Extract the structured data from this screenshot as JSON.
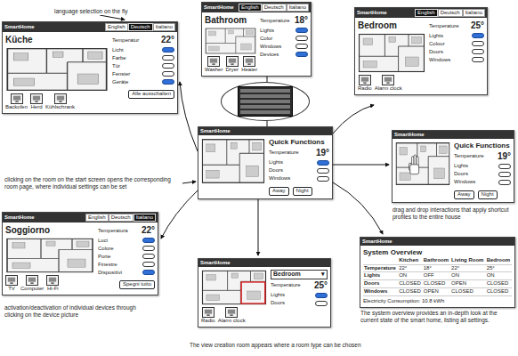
{
  "brand": "SmartHome",
  "annotations": [
    "language selection on the fly",
    "clicking on the room on the start screen opens the corresponding room page, where individual settings can be set",
    "activation/deactivation of individual devices through clicking on the device picture",
    "The view creation room appears where a room type can be chosen",
    "drag and drop interactions that apply shortcut profiles to the entire house",
    "The system overview provides an in-depth look at the current state of the smart home, listing all settings."
  ],
  "windows": [
    {
      "kind": "room",
      "title": "Küche",
      "languages": [
        {
          "label": "English",
          "selected": false
        },
        {
          "label": "Deutsch",
          "selected": true
        },
        {
          "label": "Italiano",
          "selected": false
        }
      ],
      "temperature": {
        "label": "Temperatur",
        "value": "22°"
      },
      "rows": [
        {
          "label": "Licht",
          "on": true
        },
        {
          "label": "Farbe",
          "on": false
        },
        {
          "label": "Tür",
          "on": false
        },
        {
          "label": "Fenster",
          "on": false
        },
        {
          "label": "Geräte",
          "on": true
        }
      ],
      "devices": [
        "Backofen",
        "Herd",
        "Kühlschrank"
      ],
      "button": "Alle ausschalten"
    },
    {
      "kind": "room",
      "title": "Bathroom",
      "languages": [
        {
          "label": "English",
          "selected": true
        },
        {
          "label": "Deutsch",
          "selected": false
        },
        {
          "label": "Italiano",
          "selected": false
        }
      ],
      "temperature": {
        "label": "Temperature",
        "value": "18°"
      },
      "rows": [
        {
          "label": "Lights",
          "on": true
        },
        {
          "label": "Color",
          "on": false
        },
        {
          "label": "Windows",
          "on": false
        },
        {
          "label": "Devices",
          "on": true
        }
      ],
      "devices": [
        "Washer",
        "Dryer",
        "Heater"
      ]
    },
    {
      "kind": "room",
      "title": "Bedroom",
      "languages": [
        {
          "label": "English",
          "selected": true
        },
        {
          "label": "Deutsch",
          "selected": false
        },
        {
          "label": "Italiano",
          "selected": false
        }
      ],
      "temperature": {
        "label": "Temperature",
        "value": "25°"
      },
      "rows": [
        {
          "label": "Lights",
          "on": true
        },
        {
          "label": "Colour",
          "on": false
        },
        {
          "label": "Doors",
          "on": false
        },
        {
          "label": "Windows",
          "on": false
        }
      ],
      "devices": [
        "Radio",
        "Alarm clock"
      ]
    },
    {
      "kind": "room",
      "title": "Soggiorno",
      "languages": [
        {
          "label": "English",
          "selected": false
        },
        {
          "label": "Deutsch",
          "selected": false
        },
        {
          "label": "Italiano",
          "selected": true
        }
      ],
      "temperature": {
        "label": "Temperatura",
        "value": "22°"
      },
      "rows": [
        {
          "label": "Luci",
          "on": true
        },
        {
          "label": "Colore",
          "on": false
        },
        {
          "label": "Porte",
          "on": false
        },
        {
          "label": "Finestre",
          "on": false
        },
        {
          "label": "Dispositivi",
          "on": true
        }
      ],
      "devices": [
        "TV",
        "Computer",
        "Hi-Fi"
      ],
      "button": "Spegni tutto"
    },
    {
      "kind": "quick",
      "title": "Quick Functions",
      "temperature": {
        "label": "Temperature",
        "value": "19°"
      },
      "rows": [
        {
          "label": "Lights",
          "on": true
        },
        {
          "label": "Doors",
          "on": false
        },
        {
          "label": "Windows",
          "on": false
        }
      ],
      "shortcuts": [
        "Away",
        "Night"
      ]
    },
    {
      "kind": "quick",
      "title": "Quick Functions",
      "cursor": true,
      "temperature": {
        "label": "Temperature",
        "value": "19°"
      },
      "rows": [
        {
          "label": "Lights",
          "on": false
        },
        {
          "label": "Doors",
          "on": false
        },
        {
          "label": "Windows",
          "on": false
        }
      ],
      "shortcuts": [
        "Away",
        "Night"
      ]
    },
    {
      "kind": "create",
      "room_type": "Bedroom",
      "dropdown_icon": "▾",
      "highlight": true,
      "temperature": {
        "label": "Temperature",
        "value": "25°"
      },
      "rows": [
        {
          "label": "Lights",
          "on": true
        },
        {
          "label": "Doors",
          "on": false
        }
      ],
      "devices": [
        "Radio",
        "Alarm clock"
      ]
    },
    {
      "kind": "overview",
      "title": "System Overview",
      "columns": [
        "Kitchen",
        "Bathroom",
        "Living Room",
        "Bedroom"
      ],
      "rows": [
        {
          "label": "Temperature",
          "cells": [
            "22°",
            "18°",
            "22°",
            "25°"
          ]
        },
        {
          "label": "Lights",
          "cells": [
            "ON",
            "OFF",
            "ON",
            "ON"
          ]
        },
        {
          "label": "Doors",
          "cells": [
            "CLOSED",
            "CLOSED",
            "OPEN",
            "CLOSED"
          ]
        },
        {
          "label": "Windows",
          "cells": [
            "CLOSED",
            "OPEN",
            "CLOSED",
            "CLOSED"
          ]
        }
      ],
      "footer": "Electricity Consumption: 10.8 kWh"
    }
  ]
}
